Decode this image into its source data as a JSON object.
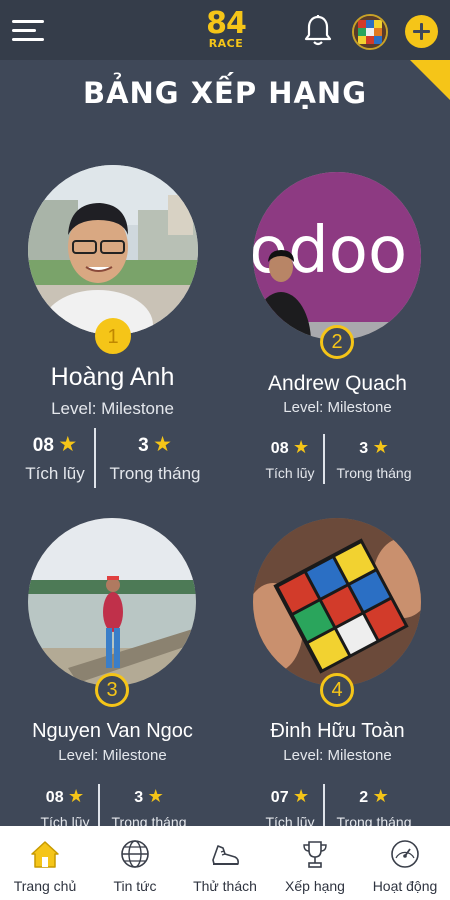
{
  "app": {
    "logo_number": "84",
    "logo_word": "RACE"
  },
  "header": {
    "menu_icon": "hamburger-menu-icon",
    "bell_icon": "bell-icon",
    "avatar_icon": "user-avatar",
    "add_icon": "plus-icon"
  },
  "page": {
    "title": "BẢNG XẾP HẠNG"
  },
  "leaderboard": [
    {
      "rank": "1",
      "name": "Hoàng Anh",
      "level": "Level: Milestone",
      "total": "08",
      "total_label": "Tích lũy",
      "month": "3",
      "month_label": "Trong tháng"
    },
    {
      "rank": "2",
      "name": "Andrew Quach",
      "level": "Level: Milestone",
      "total": "08",
      "total_label": "Tích lũy",
      "month": "3",
      "month_label": "Trong tháng"
    },
    {
      "rank": "3",
      "name": "Nguyen Van Ngoc",
      "level": "Level: Milestone",
      "total": "08",
      "total_label": "Tích lũy",
      "month": "3",
      "month_label": "Trong tháng"
    },
    {
      "rank": "4",
      "name": "Đinh Hữu Toàn",
      "level": "Level: Milestone",
      "total": "07",
      "total_label": "Tích lũy",
      "month": "2",
      "month_label": "Trong tháng"
    }
  ],
  "bottom_nav": [
    {
      "label": "Trang chủ",
      "icon": "home-icon",
      "active": true
    },
    {
      "label": "Tin tức",
      "icon": "globe-icon",
      "active": false
    },
    {
      "label": "Thử thách",
      "icon": "running-shoe-icon",
      "active": false
    },
    {
      "label": "Xếp hạng",
      "icon": "trophy-icon",
      "active": false
    },
    {
      "label": "Hoạt động",
      "icon": "speedometer-icon",
      "active": false
    }
  ],
  "colors": {
    "background": "#3f4858",
    "header": "#353d4a",
    "accent": "#f5c518",
    "nav_background": "#ffffff"
  }
}
